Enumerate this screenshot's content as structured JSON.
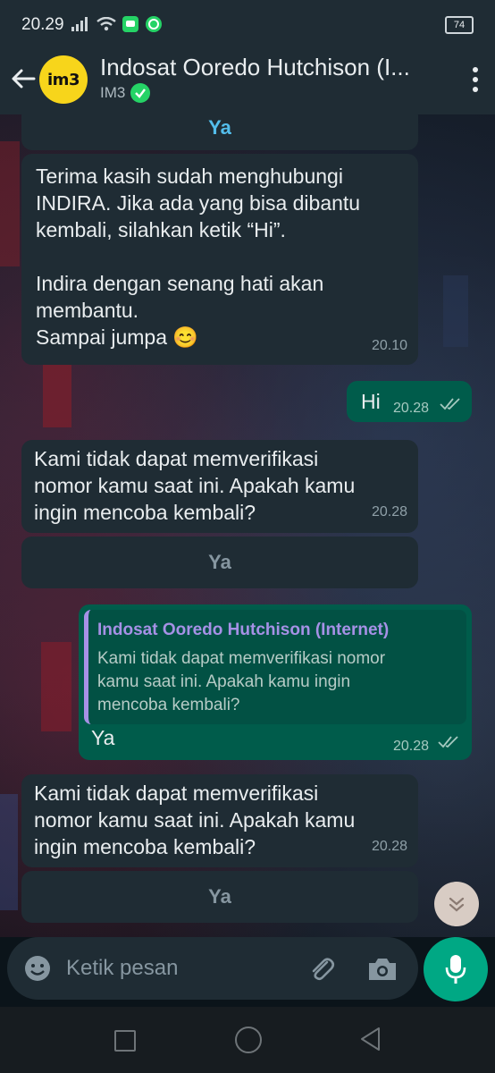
{
  "status_bar": {
    "time": "20.29",
    "battery": "74"
  },
  "header": {
    "title": "Indosat Ooredo Hutchison (I...",
    "subtitle": "IM3",
    "avatar_text": "im3"
  },
  "messages": [
    {
      "kind": "button",
      "label": "Ya"
    },
    {
      "kind": "incoming",
      "text": "Terima kasih sudah menghubungi\nINDIRA. Jika ada yang bisa dibantu\nkembali, silahkan ketik “Hi”.\n\nIndira dengan senang hati akan\nmembantu.\nSampai jumpa 😊",
      "time": "20.10"
    },
    {
      "kind": "outgoing",
      "text": "Hi",
      "time": "20.28"
    },
    {
      "kind": "incoming",
      "text": "Kami tidak dapat memverifikasi\nnomor kamu saat ini. Apakah kamu\ningin mencoba kembali?",
      "time": "20.28"
    },
    {
      "kind": "button",
      "label": "Ya"
    },
    {
      "kind": "outgoing_reply",
      "quote_name": "Indosat Ooredo Hutchison (Internet)",
      "quote_text": "Kami tidak dapat memverifikasi nomor\nkamu saat ini. Apakah kamu ingin\nmencoba kembali?",
      "text": "Ya",
      "time": "20.28"
    },
    {
      "kind": "incoming",
      "text": "Kami tidak dapat memverifikasi\nnomor kamu saat ini. Apakah kamu\ningin mencoba kembali?",
      "time": "20.28"
    },
    {
      "kind": "button",
      "label": "Ya"
    }
  ],
  "input": {
    "placeholder": "Ketik pesan"
  },
  "colors": {
    "header_bg": "#1f2c34",
    "incoming_bubble": "#1f2c34",
    "outgoing_bubble": "#005c4b",
    "accent_green": "#00a884",
    "link_blue": "#53bdeb",
    "quote_purple": "#a691e6"
  },
  "icons": [
    "back-arrow-icon",
    "verified-icon",
    "menu-dots-icon",
    "read-ticks-icon",
    "scroll-down-icon",
    "emoji-icon",
    "attach-icon",
    "camera-icon",
    "mic-icon"
  ]
}
